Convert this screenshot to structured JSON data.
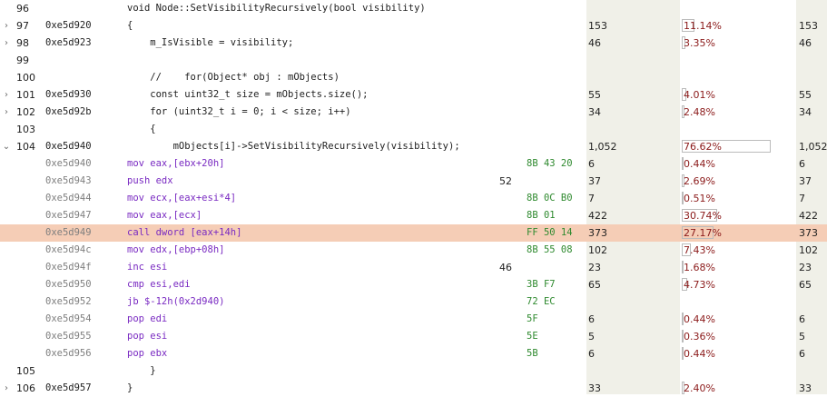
{
  "rows": [
    {
      "chev": "",
      "line": "96",
      "addr": "",
      "text": "void Node::SetVisibilityRecursively(bool visibility)",
      "kind": "src",
      "hex": "",
      "extra": "",
      "count": "",
      "pct": "",
      "frac": 0,
      "count2": "",
      "hl": false
    },
    {
      "chev": "›",
      "line": "97",
      "addr": "0xe5d920",
      "text": "{",
      "kind": "src",
      "hex": "",
      "extra": "",
      "count": "153",
      "pct": "11.14%",
      "frac": 0.1114,
      "count2": "153",
      "hl": false
    },
    {
      "chev": "›",
      "line": "98",
      "addr": "0xe5d923",
      "text": "    m_IsVisible = visibility;",
      "kind": "src",
      "hex": "",
      "extra": "",
      "count": "46",
      "pct": "3.35%",
      "frac": 0.0335,
      "count2": "46",
      "hl": false
    },
    {
      "chev": "",
      "line": "99",
      "addr": "",
      "text": "",
      "kind": "src",
      "hex": "",
      "extra": "",
      "count": "",
      "pct": "",
      "frac": 0,
      "count2": "",
      "hl": false
    },
    {
      "chev": "",
      "line": "100",
      "addr": "",
      "text": "    //    for(Object* obj : mObjects)",
      "kind": "src",
      "hex": "",
      "extra": "",
      "count": "",
      "pct": "",
      "frac": 0,
      "count2": "",
      "hl": false
    },
    {
      "chev": "›",
      "line": "101",
      "addr": "0xe5d930",
      "text": "    const uint32_t size = mObjects.size();",
      "kind": "src",
      "hex": "",
      "extra": "",
      "count": "55",
      "pct": "4.01%",
      "frac": 0.0401,
      "count2": "55",
      "hl": false
    },
    {
      "chev": "›",
      "line": "102",
      "addr": "0xe5d92b",
      "text": "    for (uint32_t i = 0; i < size; i++)",
      "kind": "src",
      "hex": "",
      "extra": "",
      "count": "34",
      "pct": "2.48%",
      "frac": 0.0248,
      "count2": "34",
      "hl": false
    },
    {
      "chev": "",
      "line": "103",
      "addr": "",
      "text": "    {",
      "kind": "src",
      "hex": "",
      "extra": "",
      "count": "",
      "pct": "",
      "frac": 0,
      "count2": "",
      "hl": false
    },
    {
      "chev": "⌄",
      "line": "104",
      "addr": "0xe5d940",
      "text": "        mObjects[i]->SetVisibilityRecursively(visibility);",
      "kind": "src",
      "hex": "",
      "extra": "",
      "count": "1,052",
      "pct": "76.62%",
      "frac": 0.7662,
      "count2": "1,052",
      "hl": false
    },
    {
      "chev": "",
      "line": "",
      "addr": "0xe5d940",
      "text": "mov eax,[ebx+20h]",
      "kind": "asm",
      "hex": "8B 43 20",
      "extra": "",
      "count": "6",
      "pct": "0.44%",
      "frac": 0.0044,
      "count2": "6",
      "hl": false
    },
    {
      "chev": "",
      "line": "",
      "addr": "0xe5d943",
      "text": "push edx",
      "kind": "asm",
      "hex": "",
      "extra": "52",
      "count": "37",
      "pct": "2.69%",
      "frac": 0.0269,
      "count2": "37",
      "hl": false
    },
    {
      "chev": "",
      "line": "",
      "addr": "0xe5d944",
      "text": "mov ecx,[eax+esi*4]",
      "kind": "asm",
      "hex": "8B 0C B0",
      "extra": "",
      "count": "7",
      "pct": "0.51%",
      "frac": 0.0051,
      "count2": "7",
      "hl": false
    },
    {
      "chev": "",
      "line": "",
      "addr": "0xe5d947",
      "text": "mov eax,[ecx]",
      "kind": "asm",
      "hex": "8B 01",
      "extra": "",
      "count": "422",
      "pct": "30.74%",
      "frac": 0.3074,
      "count2": "422",
      "hl": false
    },
    {
      "chev": "",
      "line": "",
      "addr": "0xe5d949",
      "text": "call dword [eax+14h]",
      "kind": "asm",
      "hex": "FF 50 14",
      "extra": "",
      "count": "373",
      "pct": "27.17%",
      "frac": 0.2717,
      "count2": "373",
      "hl": true
    },
    {
      "chev": "",
      "line": "",
      "addr": "0xe5d94c",
      "text": "mov edx,[ebp+08h]",
      "kind": "asm",
      "hex": "8B 55 08",
      "extra": "",
      "count": "102",
      "pct": "7.43%",
      "frac": 0.0743,
      "count2": "102",
      "hl": false
    },
    {
      "chev": "",
      "line": "",
      "addr": "0xe5d94f",
      "text": "inc esi",
      "kind": "asm",
      "hex": "",
      "extra": "46",
      "count": "23",
      "pct": "1.68%",
      "frac": 0.0168,
      "count2": "23",
      "hl": false
    },
    {
      "chev": "",
      "line": "",
      "addr": "0xe5d950",
      "text": "cmp esi,edi",
      "kind": "asm",
      "hex": "3B F7",
      "extra": "",
      "count": "65",
      "pct": "4.73%",
      "frac": 0.0473,
      "count2": "65",
      "hl": false
    },
    {
      "chev": "",
      "line": "",
      "addr": "0xe5d952",
      "text": "jb $-12h(0x2d940)",
      "kind": "asm",
      "hex": "72 EC",
      "extra": "",
      "count": "",
      "pct": "",
      "frac": 0,
      "count2": "",
      "hl": false
    },
    {
      "chev": "",
      "line": "",
      "addr": "0xe5d954",
      "text": "pop edi",
      "kind": "asm",
      "hex": "5F",
      "extra": "",
      "count": "6",
      "pct": "0.44%",
      "frac": 0.0044,
      "count2": "6",
      "hl": false
    },
    {
      "chev": "",
      "line": "",
      "addr": "0xe5d955",
      "text": "pop esi",
      "kind": "asm",
      "hex": "5E",
      "extra": "",
      "count": "5",
      "pct": "0.36%",
      "frac": 0.0036,
      "count2": "5",
      "hl": false
    },
    {
      "chev": "",
      "line": "",
      "addr": "0xe5d956",
      "text": "pop ebx",
      "kind": "asm",
      "hex": "5B",
      "extra": "",
      "count": "6",
      "pct": "0.44%",
      "frac": 0.0044,
      "count2": "6",
      "hl": false
    },
    {
      "chev": "",
      "line": "105",
      "addr": "",
      "text": "    }",
      "kind": "src",
      "hex": "",
      "extra": "",
      "count": "",
      "pct": "",
      "frac": 0,
      "count2": "",
      "hl": false
    },
    {
      "chev": "›",
      "line": "106",
      "addr": "0xe5d957",
      "text": "}",
      "kind": "src",
      "hex": "",
      "extra": "",
      "count": "33",
      "pct": "2.40%",
      "frac": 0.024,
      "count2": "33",
      "hl": false
    }
  ],
  "colors": {
    "highlight": "#f5cdb6",
    "asm": "#7a2bc2",
    "hex": "#2f8a2f",
    "pct": "#8b1a1a"
  }
}
